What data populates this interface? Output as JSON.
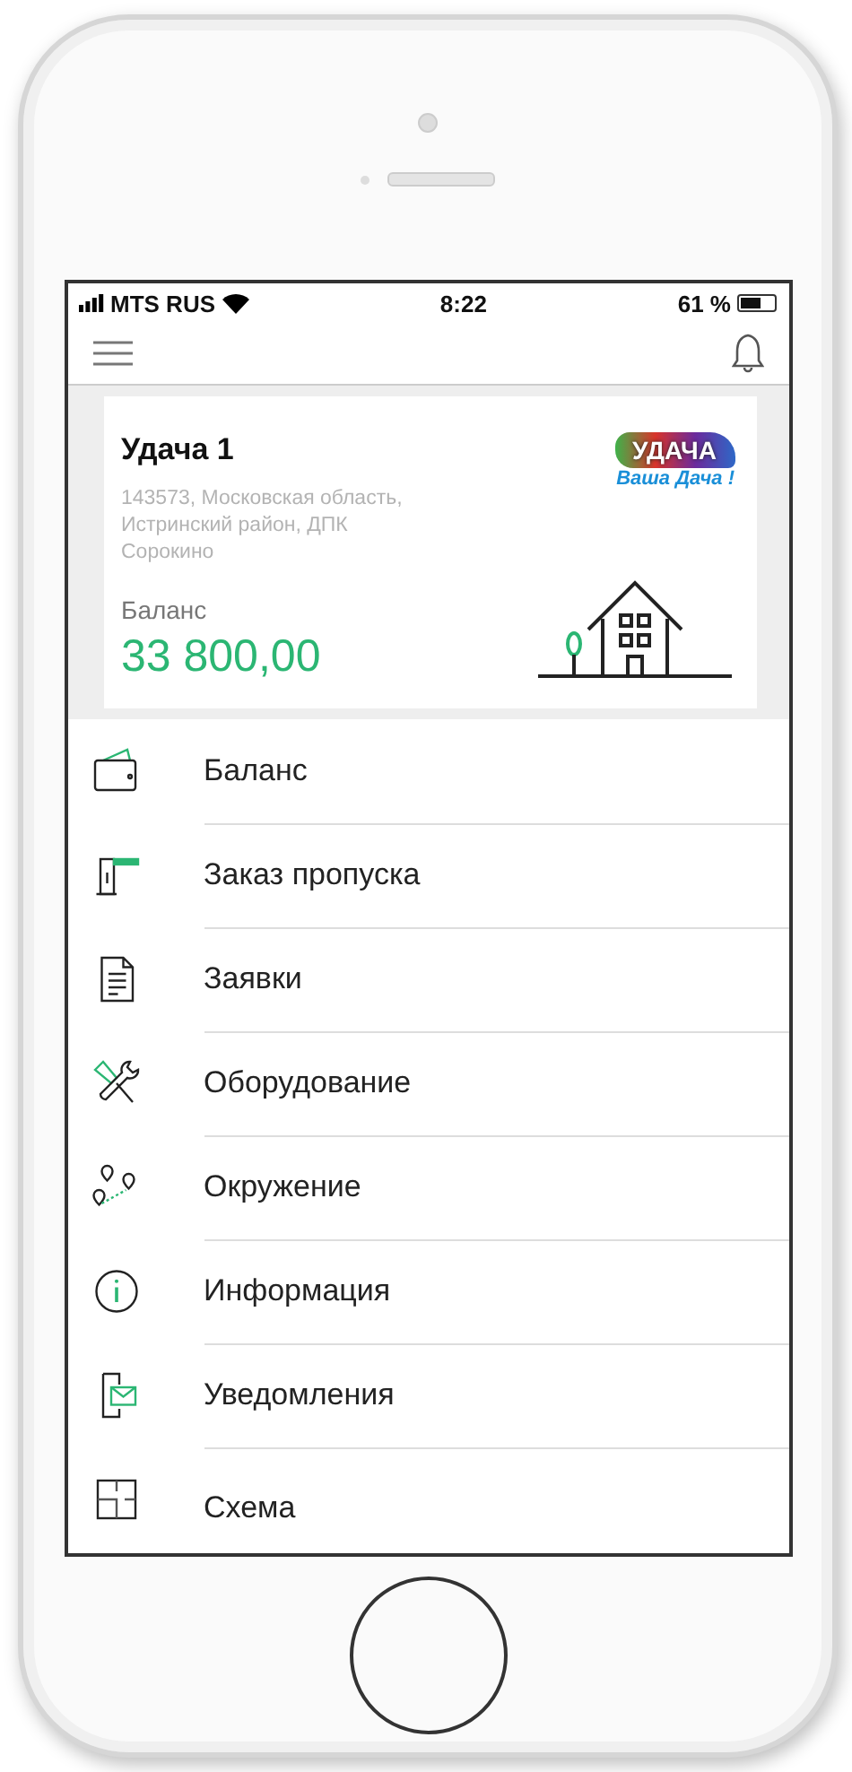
{
  "status_bar": {
    "carrier": "MTS RUS",
    "time": "8:22",
    "battery": "61 %"
  },
  "account_card": {
    "title": "Удача 1",
    "address": "143573, Московская область, Истринский район, ДПК Сорокино",
    "balance_label": "Баланс",
    "balance": "33 800,00",
    "logo_title": "УДАЧА",
    "logo_slogan": "Ваша Дача !"
  },
  "menu": [
    {
      "label": "Баланс",
      "kind": "wallet"
    },
    {
      "label": "Заказ пропуска",
      "kind": "barrier"
    },
    {
      "label": "Заявки",
      "kind": "document"
    },
    {
      "label": "Оборудование",
      "kind": "tools"
    },
    {
      "label": "Окружение",
      "kind": "pins"
    },
    {
      "label": "Информация",
      "kind": "info"
    },
    {
      "label": "Уведомления",
      "kind": "mail"
    },
    {
      "label": "Схема",
      "kind": "plan"
    }
  ]
}
